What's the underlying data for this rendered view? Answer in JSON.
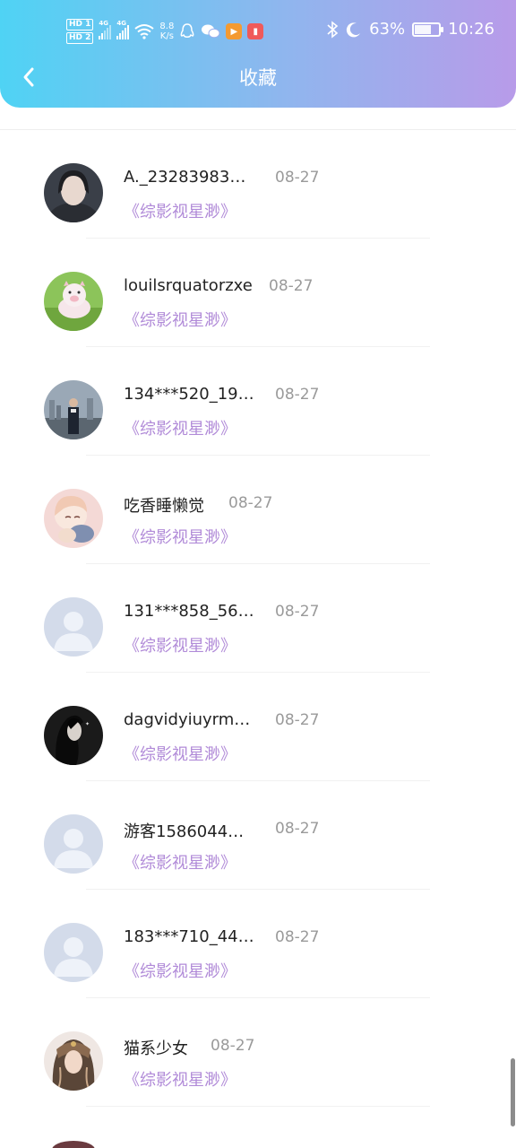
{
  "status_bar": {
    "hd1": "HD 1",
    "hd2": "HD 2",
    "net1": "4G",
    "net2": "4G",
    "speed_value": "8.8",
    "speed_unit": "K/s",
    "battery": "63%",
    "time": "10:26",
    "icons": [
      "qq-icon",
      "wechat-icon",
      "video-app-icon",
      "book-app-icon",
      "bluetooth-icon",
      "moon-icon",
      "battery-icon"
    ]
  },
  "header": {
    "title": "收藏",
    "back_icon": "chevron-left-icon"
  },
  "colors": {
    "header_start": "#4fd3f4",
    "header_end": "#b89be9",
    "work_title": "#b18bd8",
    "date": "#9a9a9a"
  },
  "items": [
    {
      "name": "A._23283983…",
      "date": "08-27",
      "work": "《综影视星渺》",
      "avatar": "photo-girl"
    },
    {
      "name": "louilsrquatorzxe",
      "date": "08-27",
      "work": "《综影视星渺》",
      "avatar": "pig-toy"
    },
    {
      "name": "134***520_19…",
      "date": "08-27",
      "work": "《综影视星渺》",
      "avatar": "city-man"
    },
    {
      "name": "吃香睡懒觉",
      "date": "08-27",
      "work": "《综影视星渺》",
      "avatar": "anime-girl"
    },
    {
      "name": "131***858_56…",
      "date": "08-27",
      "work": "《综影视星渺》",
      "avatar": "default"
    },
    {
      "name": "dagvidyiuyrm…",
      "date": "08-27",
      "work": "《综影视星渺》",
      "avatar": "dark-portrait"
    },
    {
      "name": "游客1586044…",
      "date": "08-27",
      "work": "《综影视星渺》",
      "avatar": "default"
    },
    {
      "name": "183***710_44…",
      "date": "08-27",
      "work": "《综影视星渺》",
      "avatar": "default"
    },
    {
      "name": "猫系少女",
      "date": "08-27",
      "work": "《综影视星渺》",
      "avatar": "veil-girl"
    }
  ]
}
